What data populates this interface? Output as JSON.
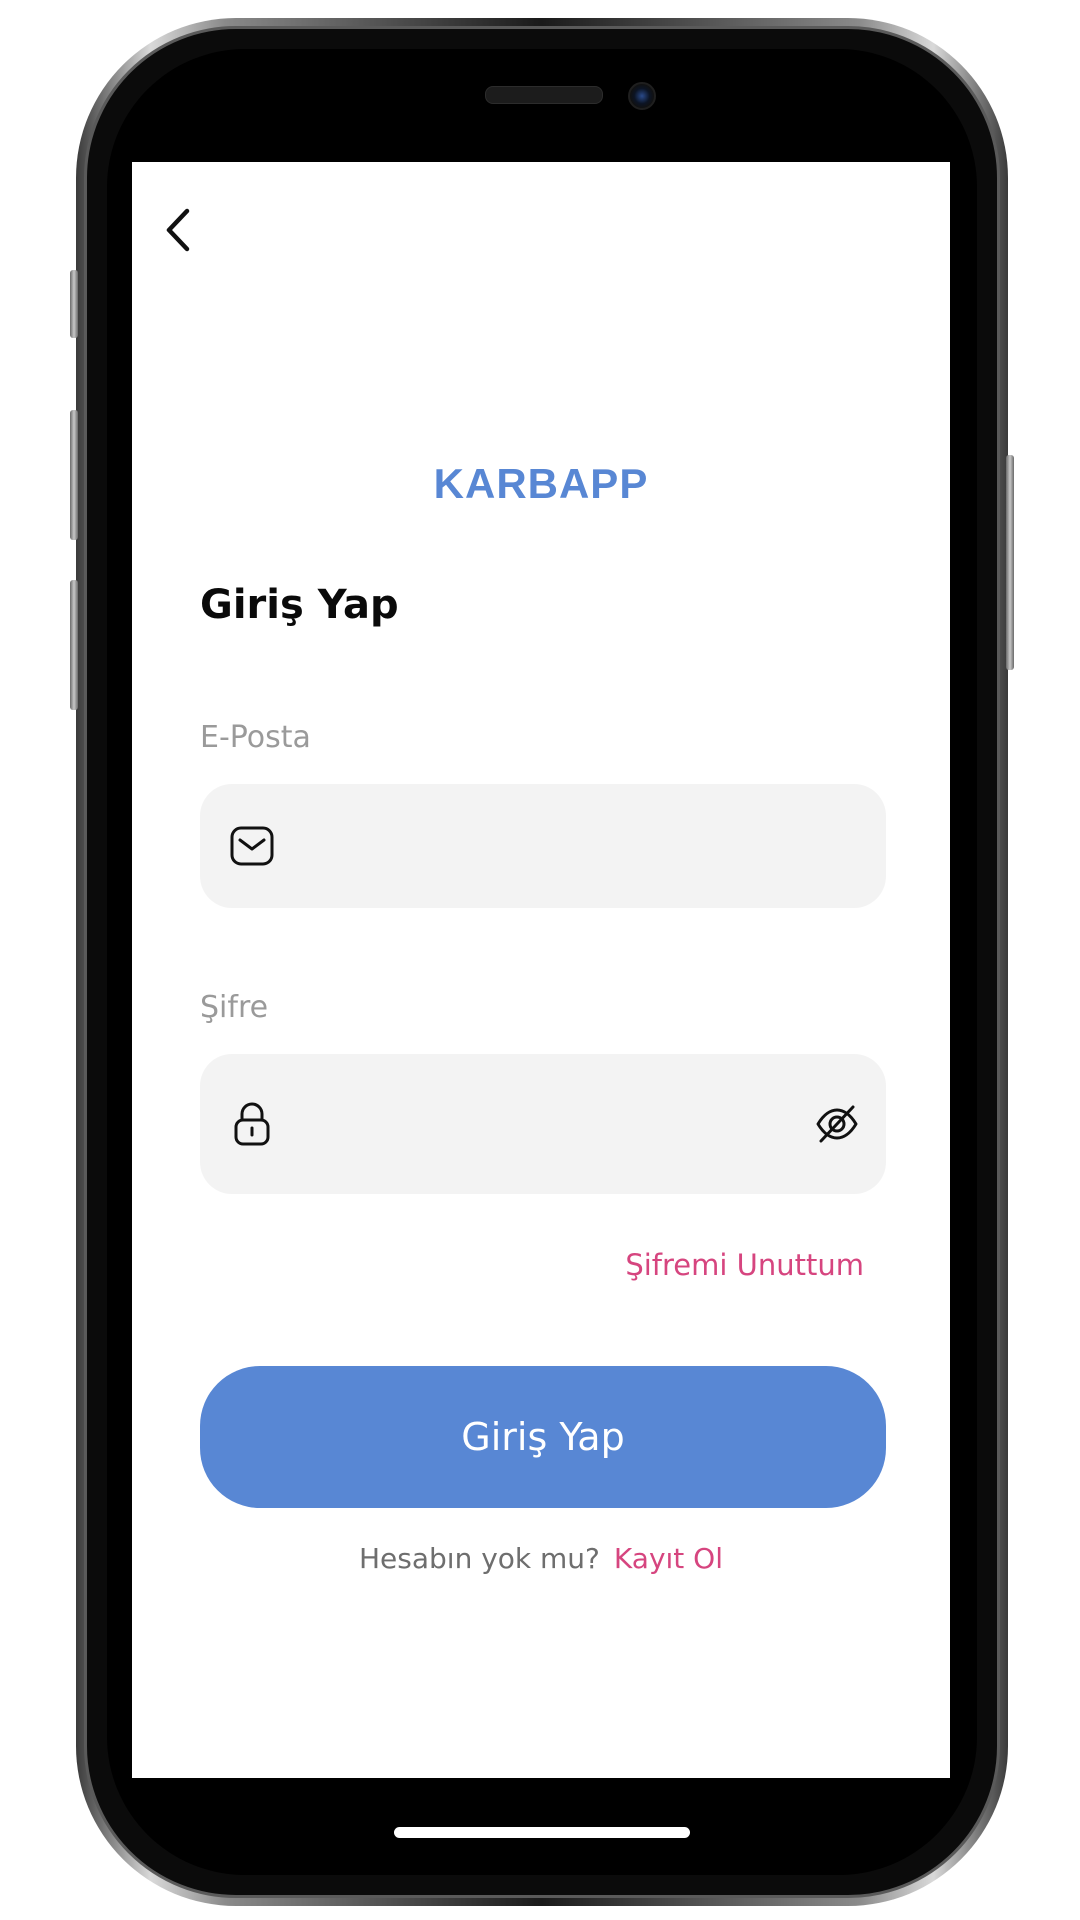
{
  "app": {
    "logo_text": "KARBAPP",
    "brand_color": "#5887d4",
    "accent_color": "#d6457f"
  },
  "header": {
    "back_icon": "chevron-left-icon"
  },
  "page": {
    "title": "Giriş Yap"
  },
  "form": {
    "email": {
      "label": "E-Posta",
      "value": "",
      "placeholder": "",
      "icon": "mail-icon"
    },
    "password": {
      "label": "Şifre",
      "value": "",
      "placeholder": "",
      "icon": "lock-icon",
      "toggle_icon": "eye-off-icon"
    },
    "forgot_password_label": "Şifremi Unuttum",
    "submit_label": "Giriş Yap"
  },
  "signup": {
    "question": "Hesabın yok mu?",
    "link_label": "Kayıt Ol"
  }
}
